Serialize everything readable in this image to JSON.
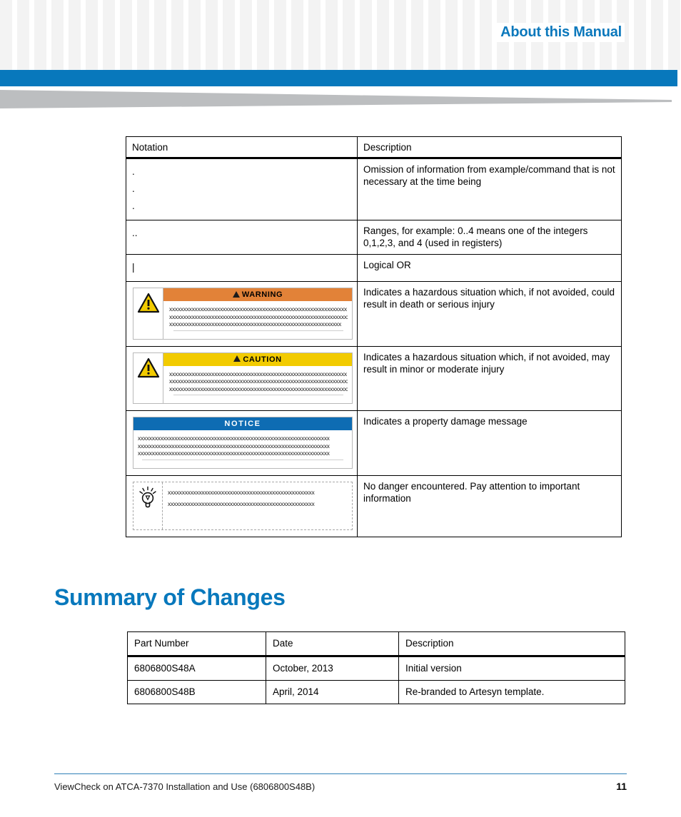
{
  "header": {
    "title": "About this Manual",
    "accent_color": "#0878bc",
    "wedge_color": "#bcbec0",
    "grid_color": "#f3f3f3"
  },
  "notation_table": {
    "columns": [
      "Notation",
      "Description"
    ],
    "rows": [
      {
        "type": "text",
        "notation_lines": [
          ".",
          ".",
          "."
        ],
        "description": "Omission of information from example/command that is not necessary at the time being"
      },
      {
        "type": "text",
        "notation_lines": [
          ".."
        ],
        "description": "Ranges, for example: 0..4 means one of the integers 0,1,2,3, and 4 (used in registers)"
      },
      {
        "type": "text",
        "notation_lines": [
          "|"
        ],
        "description": "Logical OR"
      },
      {
        "type": "alert",
        "alert": {
          "kind": "warning",
          "banner_label": "WARNING",
          "banner_color": "#e28238",
          "icon": "warning-triangle-icon",
          "placeholder_lines": [
            "xxxxxxxxxxxxxxxxxxxxxxxxxxxxxxxxxxxxxxxxxxxxxxxxxxxxxxxxxxxxxxx",
            "xxxxxxxxxxxxxxxxxxxxxxxxxxxxxxxxxxxxxxxxxxxxxxxxxxxxxxxxxxxxxxxx",
            "xxxxxxxxxxxxxxxxxxxxxxxxxxxxxxxxxxxxxxxxxxxxxxxxxxxxxxxxxxxxx"
          ]
        },
        "description": "Indicates a hazardous situation which, if not avoided, could result in death or serious injury"
      },
      {
        "type": "alert",
        "alert": {
          "kind": "caution",
          "banner_label": "CAUTION",
          "banner_color": "#f2cb00",
          "icon": "warning-triangle-icon",
          "placeholder_lines": [
            "xxxxxxxxxxxxxxxxxxxxxxxxxxxxxxxxxxxxxxxxxxxxxxxxxxxxxxxxxxxxxxx",
            "xxxxxxxxxxxxxxxxxxxxxxxxxxxxxxxxxxxxxxxxxxxxxxxxxxxxxxxxxxxxxxxx",
            "xxxxxxxxxxxxxxxxxxxxxxxxxxxxxxxxxxxxxxxxxxxxxxxxxxxxxxxxxxxxxxxx"
          ]
        },
        "description": "Indicates a hazardous situation which, if not avoided, may result in minor or moderate injury"
      },
      {
        "type": "notice",
        "alert": {
          "kind": "notice",
          "banner_label": "NOTICE",
          "banner_color": "#0e6cb3",
          "icon": null,
          "placeholder_lines": [
            "xxxxxxxxxxxxxxxxxxxxxxxxxxxxxxxxxxxxxxxxxxxxxxxxxxxxxxxxxxxxxxxxxxxx",
            "xxxxxxxxxxxxxxxxxxxxxxxxxxxxxxxxxxxxxxxxxxxxxxxxxxxxxxxxxxxxxxxxxxxx",
            "xxxxxxxxxxxxxxxxxxxxxxxxxxxxxxxxxxxxxxxxxxxxxxxxxxxxxxxxxxxxxxxxxxxx"
          ]
        },
        "description": "Indicates a property damage message"
      },
      {
        "type": "tip",
        "alert": {
          "kind": "tip",
          "banner_label": "",
          "icon": "lightbulb-icon",
          "placeholder_lines": [
            "xxxxxxxxxxxxxxxxxxxxxxxxxxxxxxxxxxxxxxxxxxxxxxxxxxxx",
            "xxxxxxxxxxxxxxxxxxxxxxxxxxxxxxxxxxxxxxxxxxxxxxxxxxxx"
          ]
        },
        "description": "No danger encountered. Pay attention to important information"
      }
    ]
  },
  "summary_heading": "Summary of Changes",
  "changes_table": {
    "columns": [
      "Part Number",
      "Date",
      "Description"
    ],
    "rows": [
      [
        "6806800S48A",
        "October, 2013",
        "Initial version"
      ],
      [
        "6806800S48B",
        "April, 2014",
        "Re-branded to Artesyn template."
      ]
    ]
  },
  "footer": {
    "text": "ViewCheck on ATCA-7370 Installation and Use (6806800S48B)",
    "page_number": "11"
  }
}
